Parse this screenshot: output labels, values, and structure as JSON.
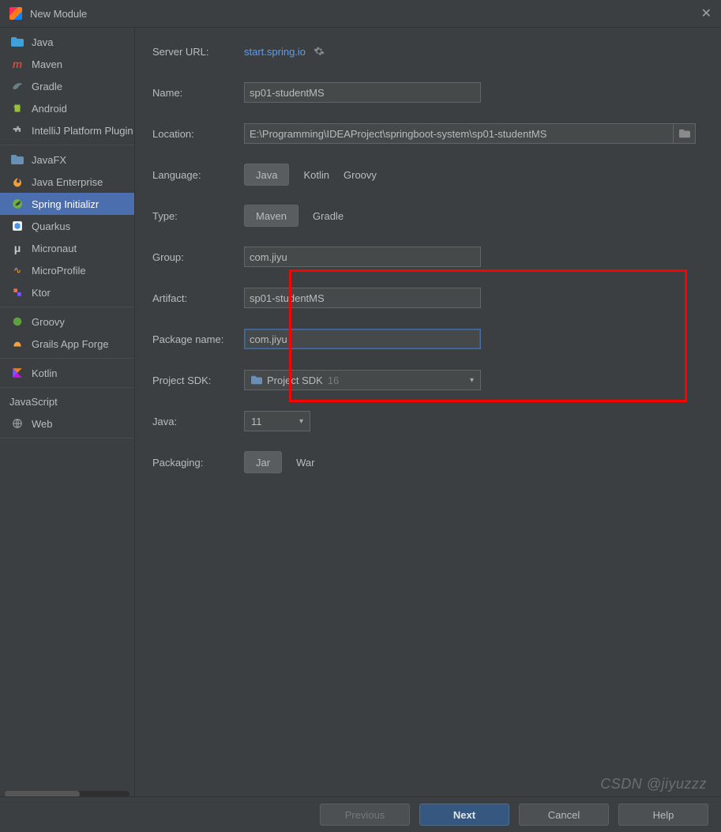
{
  "window": {
    "title": "New Module"
  },
  "sidebar": {
    "groups": [
      {
        "items": [
          {
            "label": "Java",
            "icon": "folder-java",
            "color": "#40a0d8"
          },
          {
            "label": "Maven",
            "icon": "letter-m",
            "color": "#d04a3a"
          },
          {
            "label": "Gradle",
            "icon": "gradle",
            "color": "#6b7f86"
          },
          {
            "label": "Android",
            "icon": "android",
            "color": "#97c03d"
          },
          {
            "label": "IntelliJ Platform Plugin",
            "icon": "plugin",
            "color": "#b0b0b0"
          }
        ]
      },
      {
        "items": [
          {
            "label": "JavaFX",
            "icon": "folder",
            "color": "#6a8fb5"
          },
          {
            "label": "Java Enterprise",
            "icon": "flame",
            "color": "#f29d38"
          },
          {
            "label": "Spring Initializr",
            "icon": "spring",
            "color": "#6db33f",
            "selected": true
          },
          {
            "label": "Quarkus",
            "icon": "quarkus",
            "color": "#4695eb"
          },
          {
            "label": "Micronaut",
            "icon": "letter-mu",
            "color": "#c9c9c9"
          },
          {
            "label": "MicroProfile",
            "icon": "microprofile",
            "color": "#f2a43a"
          },
          {
            "label": "Ktor",
            "icon": "ktor",
            "color": "#f26d3d"
          }
        ]
      },
      {
        "items": [
          {
            "label": "Groovy",
            "icon": "groovy",
            "color": "#5e9f3e"
          },
          {
            "label": "Grails App Forge",
            "icon": "grails",
            "color": "#f2a43a"
          }
        ]
      },
      {
        "items": [
          {
            "label": "Kotlin",
            "icon": "kotlin",
            "color": "#7f52ff"
          }
        ]
      },
      {
        "heading": "JavaScript",
        "items": [
          {
            "label": "Web",
            "icon": "globe",
            "color": "#9a9a9a"
          }
        ]
      }
    ]
  },
  "form": {
    "server_url_label": "Server URL:",
    "server_url": "start.spring.io",
    "name_label": "Name:",
    "name": "sp01-studentMS",
    "location_label": "Location:",
    "location": "E:\\Programming\\IDEAProject\\springboot-system\\sp01-studentMS",
    "language_label": "Language:",
    "language_opts": [
      "Java",
      "Kotlin",
      "Groovy"
    ],
    "language_sel": "Java",
    "type_label": "Type:",
    "type_opts": [
      "Maven",
      "Gradle"
    ],
    "type_sel": "Maven",
    "group_label": "Group:",
    "group": "com.jiyu",
    "artifact_label": "Artifact:",
    "artifact": "sp01-studentMS",
    "package_label": "Package name:",
    "package": "com.jiyu",
    "sdk_label": "Project SDK:",
    "sdk_value": "Project SDK",
    "sdk_suffix": "16",
    "java_label": "Java:",
    "java_value": "11",
    "packaging_label": "Packaging:",
    "packaging_opts": [
      "Jar",
      "War"
    ],
    "packaging_sel": "Jar"
  },
  "footer": {
    "previous": "Previous",
    "next": "Next",
    "cancel": "Cancel",
    "help": "Help"
  },
  "watermark": "CSDN @jiyuzzz"
}
